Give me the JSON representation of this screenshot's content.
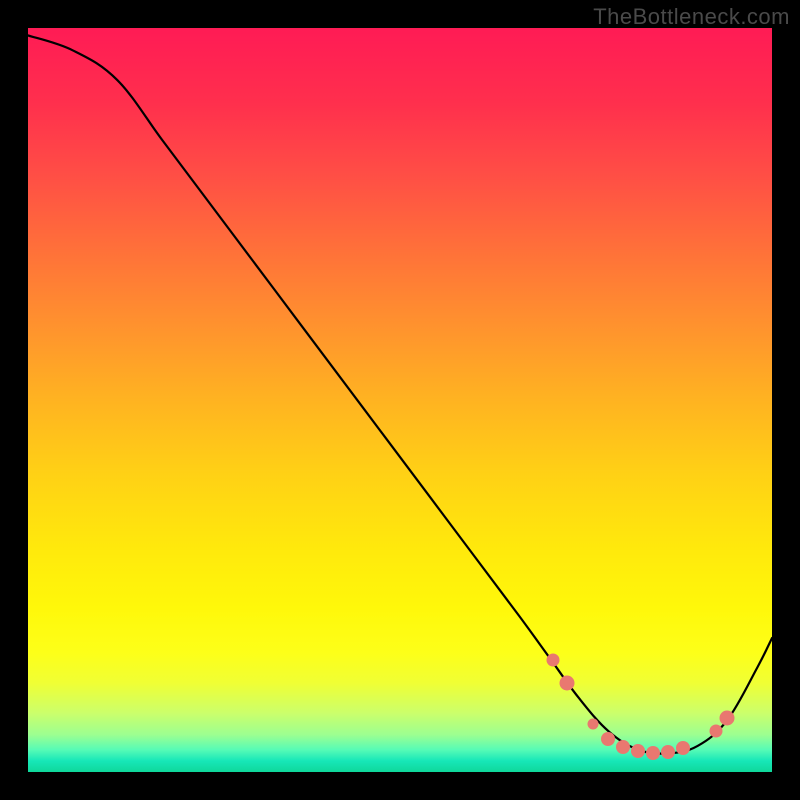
{
  "attribution": "TheBottleneck.com",
  "chart_data": {
    "type": "line",
    "title": "",
    "xlabel": "",
    "ylabel": "",
    "xlim": [
      0,
      100
    ],
    "ylim": [
      0,
      100
    ],
    "series": [
      {
        "name": "curve",
        "x": [
          0,
          6,
          12,
          18,
          24,
          30,
          36,
          42,
          48,
          54,
          60,
          66,
          70,
          74,
          78,
          82,
          86,
          90,
          94,
          98,
          100
        ],
        "y": [
          99,
          97,
          93,
          85,
          77,
          69,
          61,
          53,
          45,
          37,
          29,
          21,
          15.5,
          10,
          5.5,
          3,
          2.5,
          3.5,
          7,
          14,
          18
        ]
      }
    ],
    "markers": {
      "name": "highlighted-points",
      "color": "#e97870",
      "points": [
        {
          "x": 70.5,
          "y": 15,
          "size": 13
        },
        {
          "x": 72.5,
          "y": 12,
          "size": 15
        },
        {
          "x": 76,
          "y": 6.5,
          "size": 11
        },
        {
          "x": 78,
          "y": 4.5,
          "size": 14
        },
        {
          "x": 80,
          "y": 3.3,
          "size": 14
        },
        {
          "x": 82,
          "y": 2.8,
          "size": 14
        },
        {
          "x": 84,
          "y": 2.6,
          "size": 14
        },
        {
          "x": 86,
          "y": 2.7,
          "size": 14
        },
        {
          "x": 88,
          "y": 3.2,
          "size": 14
        },
        {
          "x": 92.5,
          "y": 5.5,
          "size": 13
        },
        {
          "x": 94,
          "y": 7.3,
          "size": 15
        }
      ]
    },
    "gradient": {
      "type": "vertical",
      "stops": [
        {
          "pos": 0.0,
          "color": "#ff1b55"
        },
        {
          "pos": 0.1,
          "color": "#ff2f4d"
        },
        {
          "pos": 0.2,
          "color": "#ff4f45"
        },
        {
          "pos": 0.3,
          "color": "#ff7139"
        },
        {
          "pos": 0.4,
          "color": "#ff922e"
        },
        {
          "pos": 0.5,
          "color": "#ffb321"
        },
        {
          "pos": 0.6,
          "color": "#ffd115"
        },
        {
          "pos": 0.7,
          "color": "#ffe90c"
        },
        {
          "pos": 0.78,
          "color": "#fff80a"
        },
        {
          "pos": 0.84,
          "color": "#fdff19"
        },
        {
          "pos": 0.88,
          "color": "#f0ff34"
        },
        {
          "pos": 0.92,
          "color": "#ccff6a"
        },
        {
          "pos": 0.95,
          "color": "#9cff91"
        },
        {
          "pos": 0.97,
          "color": "#57fbb6"
        },
        {
          "pos": 0.985,
          "color": "#17e7b8"
        },
        {
          "pos": 1.0,
          "color": "#0fd89a"
        }
      ]
    }
  }
}
